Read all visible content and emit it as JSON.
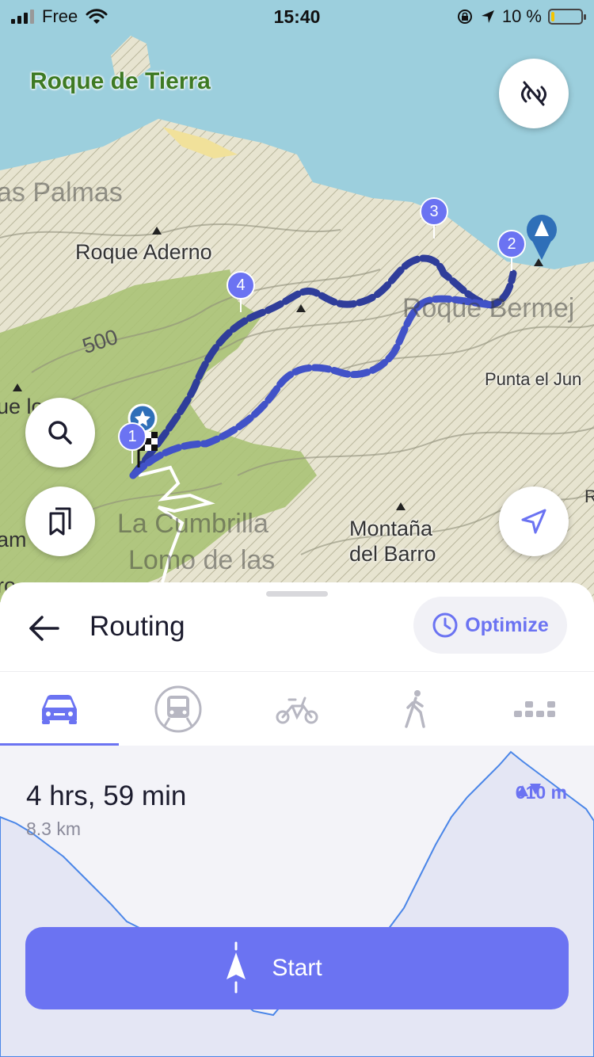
{
  "status_bar": {
    "carrier": "Free",
    "time": "15:40",
    "battery_percent": "10 %",
    "battery_level": 0.1
  },
  "map": {
    "labels": {
      "roque_de_tierra": "Roque de Tierra",
      "las_palmas": "as Palmas",
      "roque_aderno": "Roque Aderno",
      "roque_bermejo": "Roque Bermej",
      "punta_el_jun": "Punta el Jun",
      "contour_500": "500",
      "la_cumbrilla": "La Cumbrilla",
      "lomo_de_las": "Lomo de las",
      "montana_del_barro_1": "Montaña",
      "montana_del_barro_2": "del Barro",
      "edge_left_1": "ue lo",
      "edge_left_2": "am",
      "edge_left_3": "ro",
      "edge_right_r": "R"
    },
    "waypoints": [
      "1",
      "2",
      "3",
      "4"
    ]
  },
  "sheet": {
    "title": "Routing",
    "optimize_label": "Optimize",
    "tabs": [
      {
        "name": "car",
        "active": true
      },
      {
        "name": "transit",
        "active": false
      },
      {
        "name": "bike",
        "active": false
      },
      {
        "name": "walk",
        "active": false
      },
      {
        "name": "more",
        "active": false
      }
    ],
    "duration": "4 hrs, 59 min",
    "distance": "8.3 km",
    "elevation": "610 m",
    "start_label": "Start"
  },
  "colors": {
    "accent": "#6b73f2",
    "route": "#2f3d9a",
    "sea": "#9ccfdd",
    "forest": "#a9c275"
  }
}
